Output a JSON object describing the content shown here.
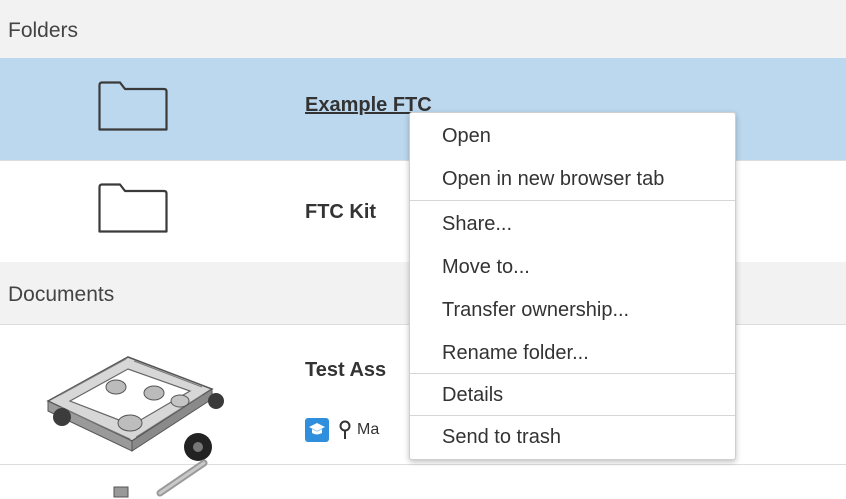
{
  "sections": {
    "folders": "Folders",
    "documents": "Documents"
  },
  "folders": [
    {
      "name": "Example FTC",
      "selected": true,
      "icon": "folder-icon"
    },
    {
      "name": "FTC Kit",
      "selected": false,
      "icon": "folder-icon"
    }
  ],
  "documents": [
    {
      "name": "Test Ass",
      "meta_text": "Ma",
      "icons": [
        "education-badge-icon",
        "location-pin-icon"
      ]
    }
  ],
  "context_menu": {
    "groups": [
      [
        "Open",
        "Open in new browser tab"
      ],
      [
        "Share...",
        "Move to...",
        "Transfer ownership...",
        "Rename folder..."
      ],
      [
        "Details",
        "Send to trash"
      ]
    ]
  },
  "colors": {
    "selection": "#bcd8ee",
    "section_header_bg": "#f2f2f2",
    "badge": "#2f8fdc"
  }
}
